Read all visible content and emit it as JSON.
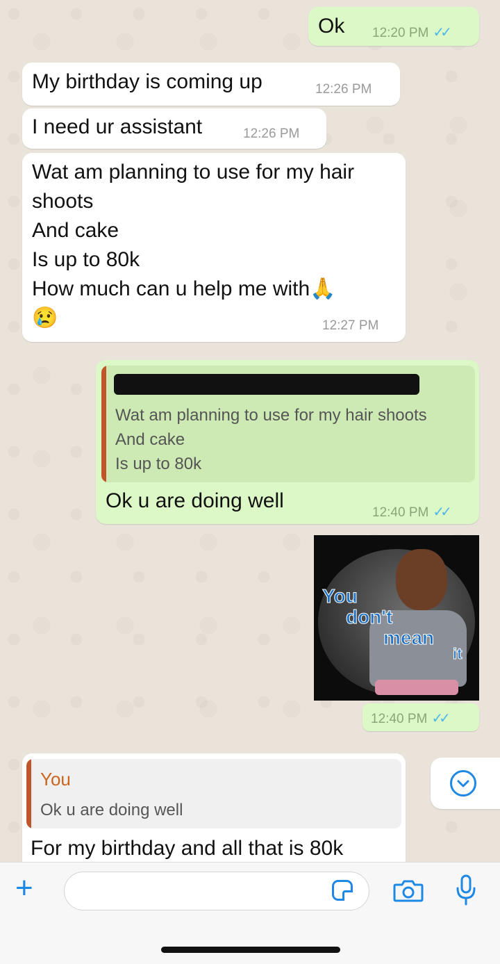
{
  "messages": [
    {
      "text": "Ok",
      "time": "12:20 PM"
    },
    {
      "text": "My birthday is coming up",
      "time": "12:26 PM"
    },
    {
      "text": "I need ur assistant",
      "time": "12:26 PM"
    },
    {
      "text": "Wat am planning to use for my hair\nshoots\nAnd cake\nIs up to 80k\nHow much can u help me with🙏\n😢",
      "time": "12:27 PM"
    },
    {
      "quoted_text": "Wat am planning to use for my hair shoots\nAnd cake\nIs up to 80k",
      "text": "Ok u are doing well",
      "time": "12:40 PM"
    },
    {
      "sticker_caption": [
        "You",
        "don't",
        "mean",
        "it"
      ],
      "time": "12:40 PM"
    },
    {
      "quoted_author": "You",
      "quoted_text": "Ok u are doing well",
      "text": "For my birthday and all that is 80k"
    }
  ],
  "composer": {
    "placeholder": ""
  },
  "icons": {
    "attach": "plus-icon",
    "sticker": "sticker-icon",
    "camera": "camera-icon",
    "mic": "microphone-icon",
    "scroll": "chevron-down-icon",
    "ticks": "double-check-icon"
  },
  "colors": {
    "incoming_bubble": "#ffffff",
    "outgoing_bubble": "#dcf8c6",
    "accent": "#1e88e5",
    "read_ticks": "#4fb6ec",
    "quote_bar": "#c0552a"
  }
}
